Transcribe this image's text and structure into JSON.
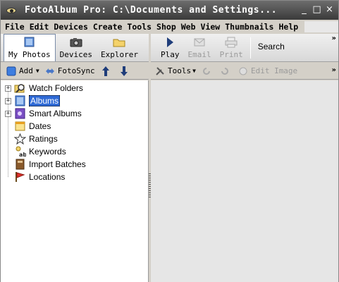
{
  "window": {
    "title": "FotoAlbum Pro:  C:\\Documents and Settings...",
    "controls": {
      "minimize": "_",
      "maximize": "□",
      "close": "×"
    }
  },
  "menu": [
    "File",
    "Edit",
    "Devices",
    "Create",
    "Tools",
    "Shop",
    "Web",
    "View",
    "Thumbnails",
    "Help"
  ],
  "toolbar_left": {
    "items": [
      {
        "label": "My Photos",
        "icon": "photos-icon",
        "active": true
      },
      {
        "label": "Devices",
        "icon": "camera-icon"
      },
      {
        "label": "Explorer",
        "icon": "folder-icon"
      }
    ]
  },
  "toolbar_right": {
    "play": "Play",
    "email": "Email",
    "print": "Print",
    "search": "Search",
    "overflow": "»"
  },
  "row2_left": {
    "add": "Add",
    "fotosync": "FotoSync"
  },
  "row2_right": {
    "tools": "Tools",
    "edit_image": "Edit Image",
    "overflow": "»"
  },
  "tree": {
    "items": [
      {
        "label": "Watch Folders",
        "icon": "magnifier-folder-icon",
        "expandable": true
      },
      {
        "label": "Albums",
        "icon": "album-icon",
        "expandable": true,
        "selected": true
      },
      {
        "label": "Smart Albums",
        "icon": "smart-album-icon",
        "expandable": true
      },
      {
        "label": "Dates",
        "icon": "calendar-icon",
        "expandable": false
      },
      {
        "label": "Ratings",
        "icon": "star-icon",
        "expandable": false
      },
      {
        "label": "Keywords",
        "icon": "keyword-icon",
        "expandable": false
      },
      {
        "label": "Import Batches",
        "icon": "import-icon",
        "expandable": false
      },
      {
        "label": "Locations",
        "icon": "flag-icon",
        "expandable": false
      }
    ]
  },
  "colors": {
    "selection": "#2f6ad6",
    "titlebar": "#4a4a4a",
    "chrome": "#d4d0c8"
  }
}
